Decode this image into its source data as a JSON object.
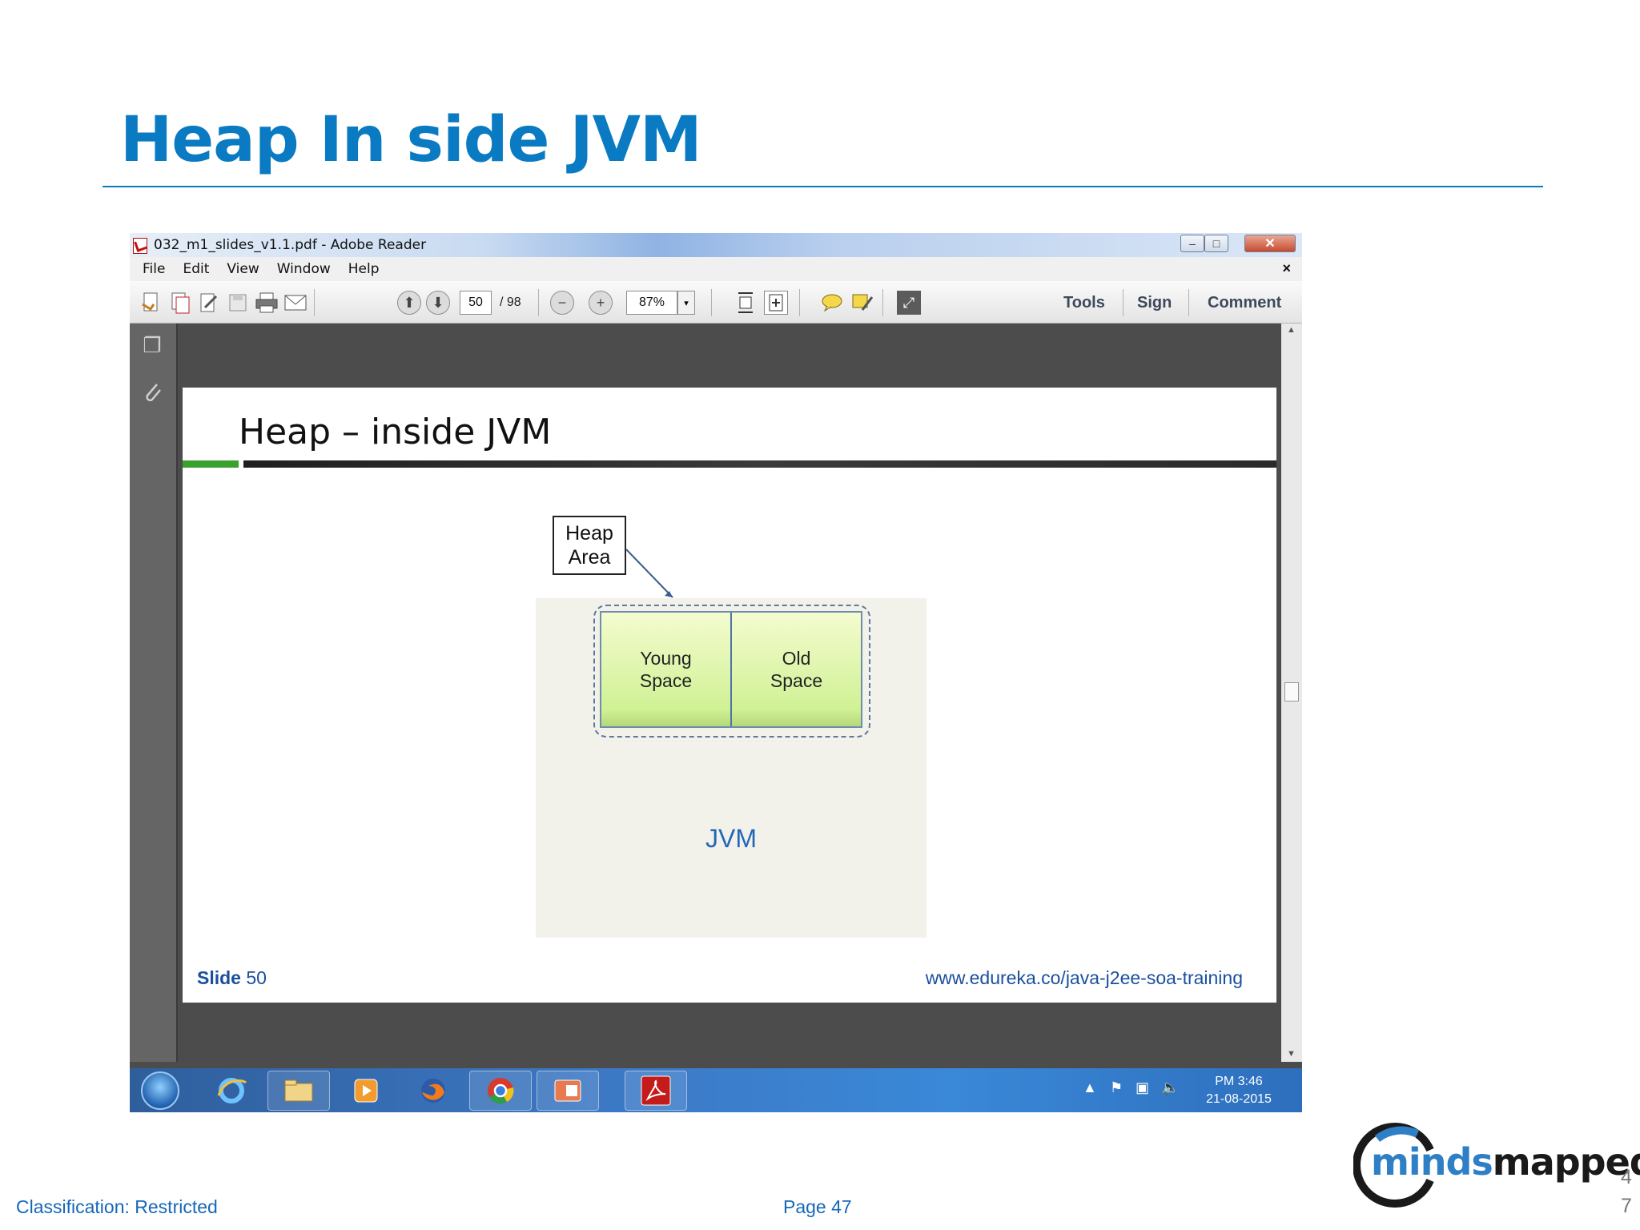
{
  "slide": {
    "title": "Heap In side JVM",
    "classification": "Classification: Restricted",
    "page_label": "Page 47",
    "slide_number": "47",
    "logo": {
      "part1": "minds",
      "part2": "mapped",
      "ring_color": "#2f7fc7"
    }
  },
  "window": {
    "title": "032_m1_slides_v1.1.pdf - Adobe Reader",
    "controls": {
      "minimize": "‒",
      "maximize": "□",
      "close": "✕"
    }
  },
  "menu": {
    "items": [
      "File",
      "Edit",
      "View",
      "Window",
      "Help"
    ],
    "doc_close": "×"
  },
  "toolbar": {
    "current_page": "50",
    "total_pages": "/ 98",
    "zoom": "87%",
    "zoom_dropdown": "▾",
    "tools_label": "Tools",
    "sign_label": "Sign",
    "comment_label": "Comment"
  },
  "document": {
    "heading": "Heap – inside JVM",
    "callout": "Heap\nArea",
    "young_space": "Young\nSpace",
    "old_space": "Old\nSpace",
    "jvm_label": "JVM",
    "footer_slide_word": "Slide",
    "footer_slide_number": "50",
    "footer_url": "www.edureka.co/java-j2ee-soa-training"
  },
  "taskbar": {
    "apps": [
      "ie-icon",
      "file-explorer-icon",
      "media-player-icon",
      "firefox-icon",
      "chrome-icon",
      "powerpoint-icon",
      "adobe-reader-icon"
    ],
    "tray_arrow": "▲",
    "clock_time": "PM 3:46",
    "clock_date": "21-08-2015"
  }
}
